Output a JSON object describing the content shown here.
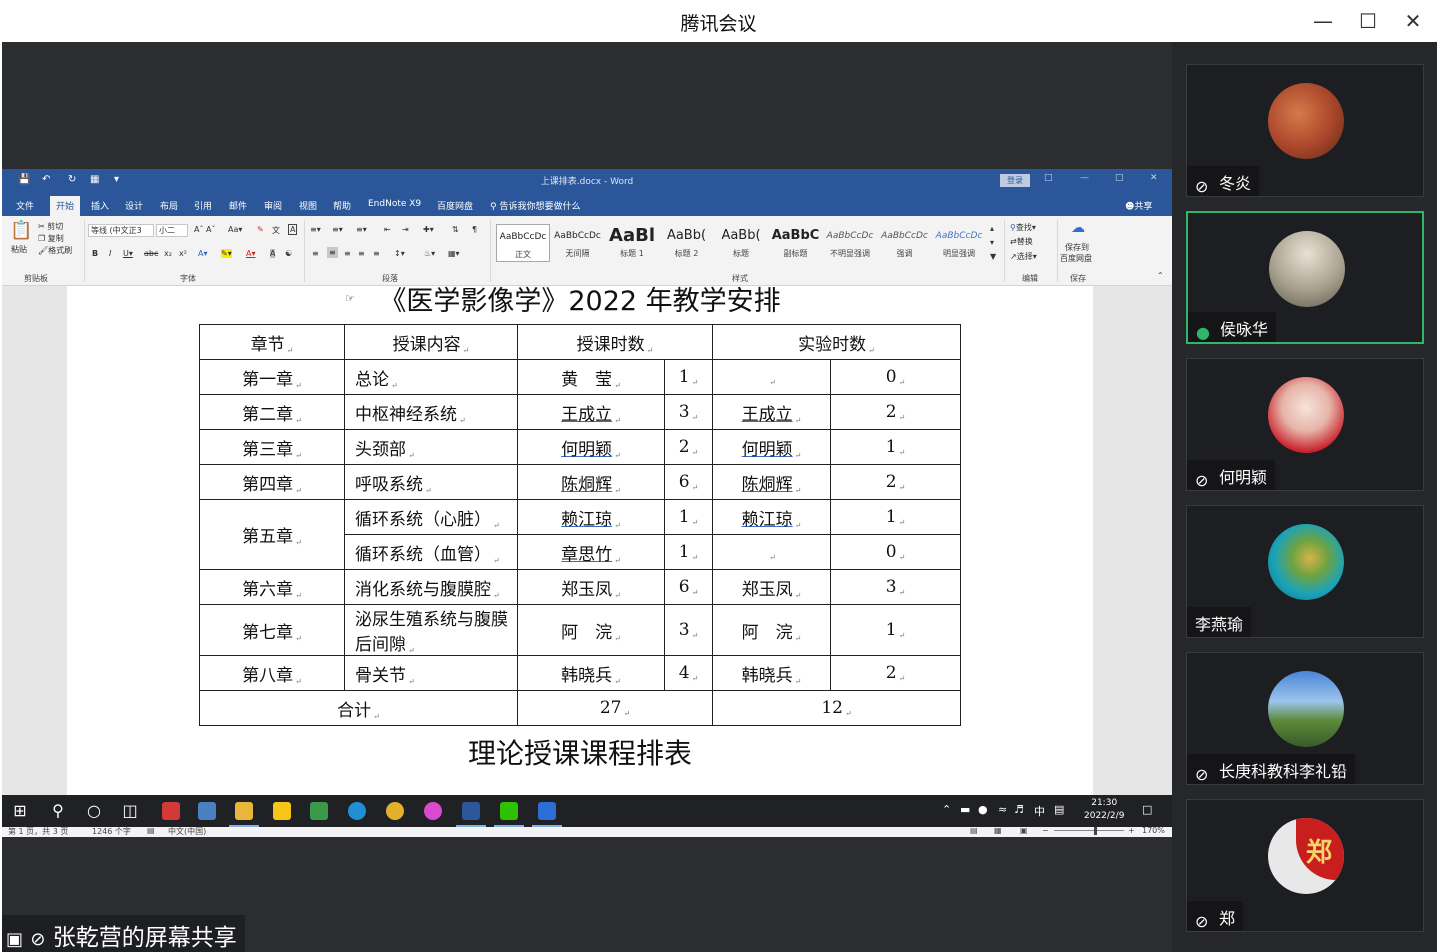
{
  "window": {
    "title": "腾讯会议"
  },
  "word": {
    "doc_title": "上课排表.docx - Word",
    "login": "登录",
    "tabs": [
      "文件",
      "开始",
      "插入",
      "设计",
      "布局",
      "引用",
      "邮件",
      "审阅",
      "视图",
      "帮助",
      "EndNote X9",
      "百度网盘"
    ],
    "active_tab": "开始",
    "tell_me": "告诉我你想要做什么",
    "share": "共享",
    "ribbon": {
      "paste": "粘贴",
      "cut": "剪切",
      "copy": "复制",
      "format_painter": "格式刷",
      "clipboard_group": "剪贴板",
      "font_name": "等线 (中文正3",
      "font_size": "小二",
      "font_group": "字体",
      "paragraph_group": "段落",
      "styles_group": "样式",
      "styles": [
        {
          "sample": "AaBbCcDc",
          "name": "正文"
        },
        {
          "sample": "AaBbCcDc",
          "name": "无间隔"
        },
        {
          "sample": "AaBl",
          "name": "标题 1"
        },
        {
          "sample": "AaBb(",
          "name": "标题 2"
        },
        {
          "sample": "AaBb(",
          "name": "标题"
        },
        {
          "sample": "AaBbC",
          "name": "副标题"
        },
        {
          "sample": "AaBbCcDc",
          "name": "不明显强调"
        },
        {
          "sample": "AaBbCcDc",
          "name": "强调"
        },
        {
          "sample": "AaBbCcDc",
          "name": "明显强调"
        }
      ],
      "find": "查找",
      "replace": "替换",
      "select": "选择",
      "editing_group": "编辑",
      "save_baidu_1": "保存到",
      "save_baidu_2": "百度网盘",
      "save_group": "保存"
    },
    "heading_top": "《医学影像学》2022 年教学安排",
    "heading_bottom": "理论授课课程排表",
    "table": {
      "headers": [
        "章节",
        "授课内容",
        "授课时数",
        "实验时数"
      ],
      "rows": [
        {
          "chapter": "第一章",
          "content": "总论",
          "teacher": "黄　莹",
          "hours": "1",
          "lab_teacher": "",
          "lab_hours": "0"
        },
        {
          "chapter": "第二章",
          "content": "中枢神经系统",
          "teacher": "王成立",
          "hours": "3",
          "lab_teacher": "王成立",
          "lab_hours": "2"
        },
        {
          "chapter": "第三章",
          "content": "头颈部",
          "teacher": "何明颖",
          "hours": "2",
          "lab_teacher": "何明颖",
          "lab_hours": "1"
        },
        {
          "chapter": "第四章",
          "content": "呼吸系统",
          "teacher": "陈烔辉",
          "hours": "6",
          "lab_teacher": "陈烔辉",
          "lab_hours": "2"
        },
        {
          "chapter": "第五章",
          "content": "循环系统（心脏）",
          "teacher": "赖江琼",
          "hours": "1",
          "lab_teacher": "赖江琼",
          "lab_hours": "1"
        },
        {
          "chapter": "",
          "content": "循环系统（血管）",
          "teacher": "章思竹",
          "hours": "1",
          "lab_teacher": "",
          "lab_hours": "0"
        },
        {
          "chapter": "第六章",
          "content": "消化系统与腹膜腔",
          "teacher": "郑玉凤",
          "hours": "6",
          "lab_teacher": "郑玉凤",
          "lab_hours": "3"
        },
        {
          "chapter": "第七章",
          "content": "泌尿生殖系统与腹膜后间隙",
          "teacher": "阿　浣",
          "hours": "3",
          "lab_teacher": "阿　浣",
          "lab_hours": "1"
        },
        {
          "chapter": "第八章",
          "content": "骨关节",
          "teacher": "韩晓兵",
          "hours": "4",
          "lab_teacher": "韩晓兵",
          "lab_hours": "2"
        }
      ],
      "total_label": "合计",
      "total_hours": "27",
      "total_lab": "12"
    },
    "status": {
      "page": "第 1 页，共 3 页",
      "words": "1246 个字",
      "lang": "中文(中国)",
      "zoom": "170%"
    }
  },
  "taskbar": {
    "time": "21:30",
    "date": "2022/2/9",
    "ime": "中"
  },
  "presenter_label": "张乾营的屏幕共享",
  "participants": [
    {
      "name": "冬炎",
      "mic": "muted",
      "speaking": false
    },
    {
      "name": "侯咏华",
      "mic": "on",
      "speaking": true
    },
    {
      "name": "何明颖",
      "mic": "muted",
      "speaking": false
    },
    {
      "name": "李燕瑜",
      "mic": "none",
      "speaking": false
    },
    {
      "name": "长庚科教科李礼铅",
      "mic": "muted",
      "speaking": false
    },
    {
      "name": "郑",
      "mic": "muted",
      "speaking": false
    }
  ],
  "avatar_text": "郑",
  "colors": {
    "word_blue": "#2b579a",
    "speaking_border": "#2fb66b",
    "share_bg": "#2b2d31"
  }
}
